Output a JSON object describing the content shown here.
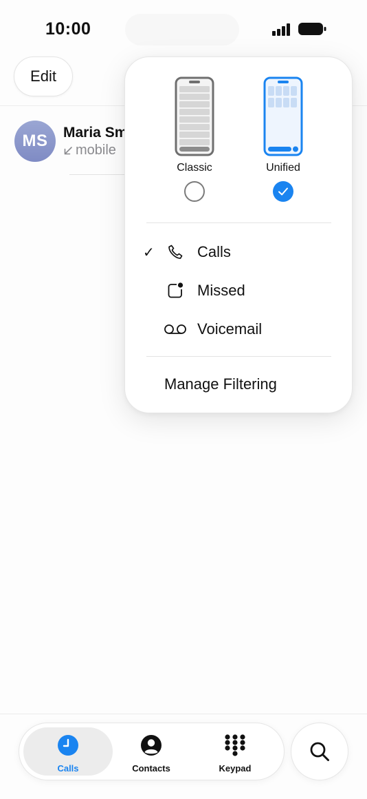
{
  "status_bar": {
    "time": "10:00"
  },
  "header": {
    "edit_label": "Edit"
  },
  "recents": [
    {
      "initials": "MS",
      "name": "Maria Sm",
      "call_type": "mobile"
    }
  ],
  "menu": {
    "layouts": [
      {
        "label": "Classic",
        "selected": false
      },
      {
        "label": "Unified",
        "selected": true
      }
    ],
    "filters": [
      {
        "label": "Calls",
        "checked": true,
        "icon": "phone-icon"
      },
      {
        "label": "Missed",
        "checked": false,
        "icon": "missed-icon"
      },
      {
        "label": "Voicemail",
        "checked": false,
        "icon": "voicemail-icon"
      }
    ],
    "manage_label": "Manage Filtering"
  },
  "tabbar": {
    "tabs": [
      {
        "label": "Calls",
        "icon": "clock-icon",
        "active": true
      },
      {
        "label": "Contacts",
        "icon": "person-icon",
        "active": false
      },
      {
        "label": "Keypad",
        "icon": "keypad-icon",
        "active": false
      }
    ],
    "search_icon": "search-icon"
  },
  "colors": {
    "accent": "#1a84f0",
    "avatar": "#8a96cc"
  }
}
